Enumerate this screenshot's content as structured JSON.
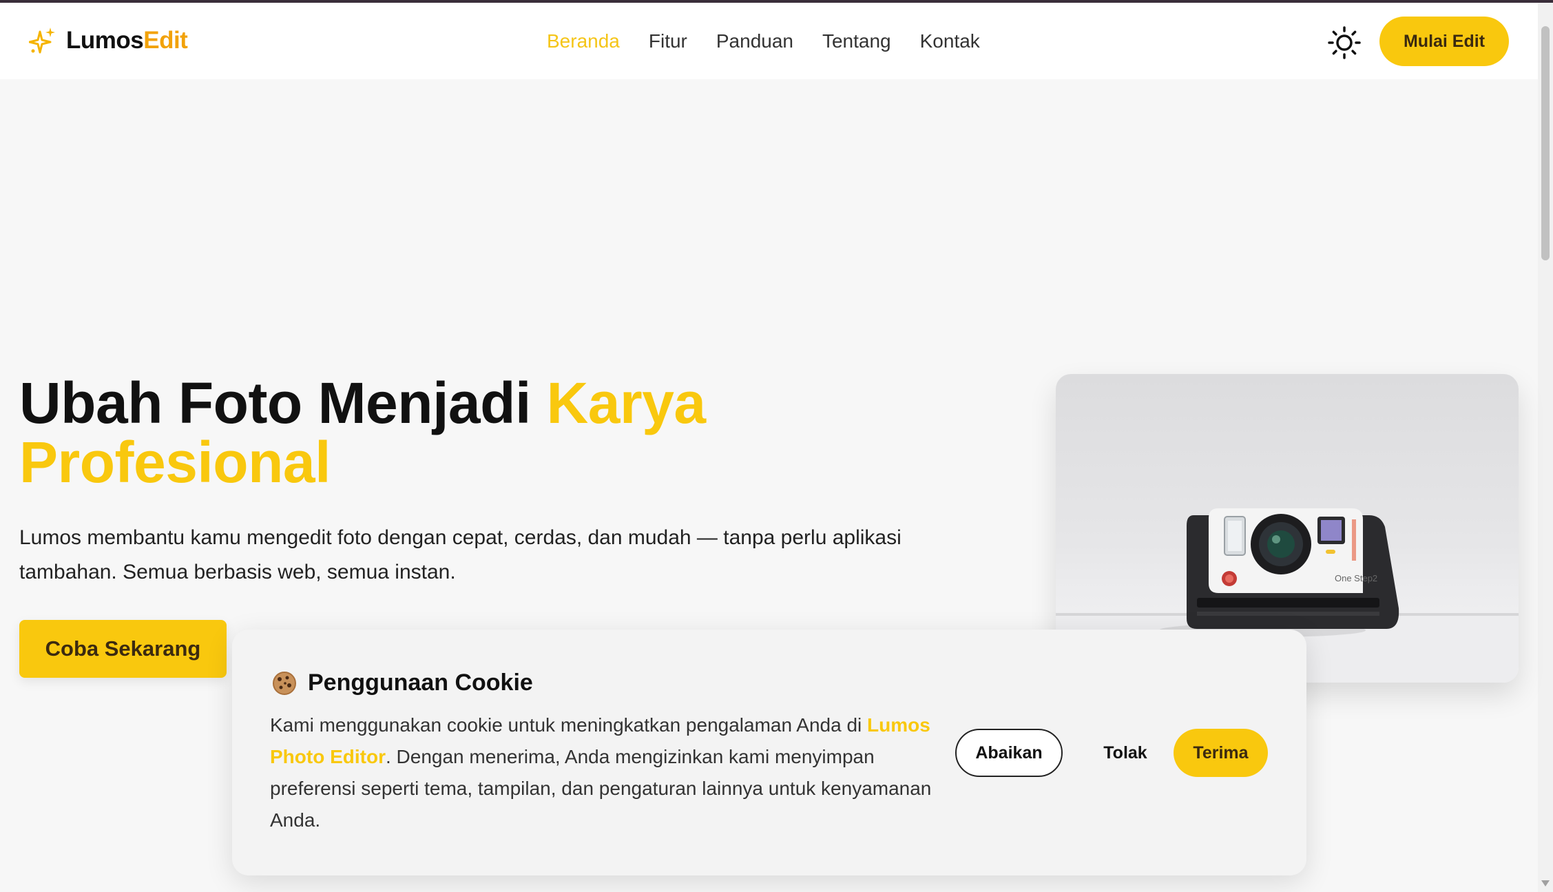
{
  "brand": {
    "name_part1": "Lumos",
    "name_part2": "Edit"
  },
  "nav": {
    "items": [
      {
        "label": "Beranda",
        "active": true
      },
      {
        "label": "Fitur",
        "active": false
      },
      {
        "label": "Panduan",
        "active": false
      },
      {
        "label": "Tentang",
        "active": false
      },
      {
        "label": "Kontak",
        "active": false
      }
    ],
    "theme_toggle_icon": "sun-icon",
    "cta_label": "Mulai Edit"
  },
  "hero": {
    "title_part1": "Ubah Foto Menjadi ",
    "title_highlight": "Karya Profesional",
    "description": "Lumos membantu kamu mengedit foto dengan cepat, cerdas, dan mudah — tanpa perlu aplikasi tambahan. Semua berbasis web, semua instan.",
    "cta_label": "Coba Sekarang",
    "image_text": "One Step2"
  },
  "cookie": {
    "icon": "cookie-icon",
    "title": "Penggunaan Cookie",
    "text_before": "Kami menggunakan cookie untuk meningkatkan pengalaman Anda di ",
    "text_brand": "Lumos Photo Editor",
    "text_after": ". Dengan menerima, Anda mengizinkan kami menyimpan preferensi seperti tema, tampilan, dan pengaturan lainnya untuk kenyamanan Anda.",
    "buttons": {
      "ignore": "Abaikan",
      "reject": "Tolak",
      "accept": "Terima"
    }
  },
  "colors": {
    "accent": "#f9c80e",
    "brand_orange": "#f2a20a",
    "text_dark": "#111111"
  }
}
